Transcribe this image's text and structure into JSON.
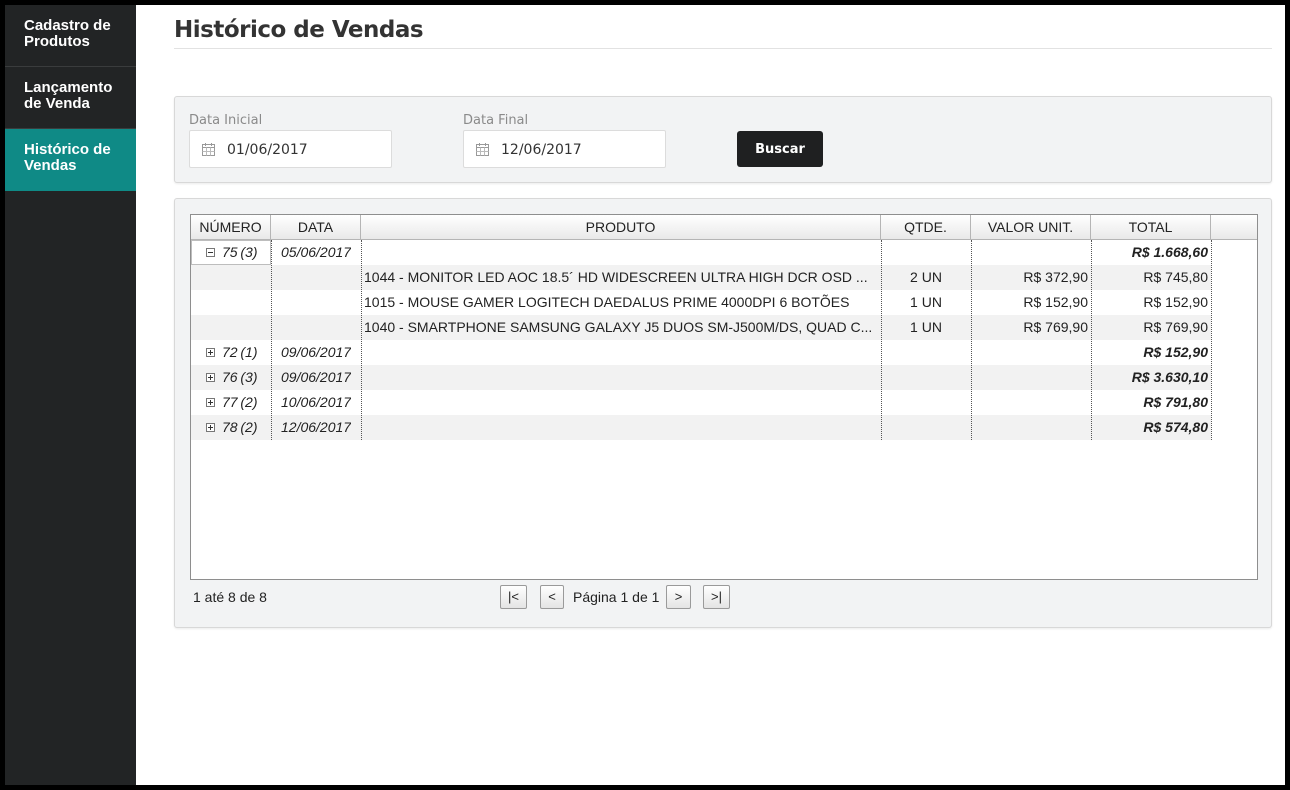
{
  "sidebar": {
    "items": [
      {
        "label_line1": "Cadastro de",
        "label_line2": "Produtos"
      },
      {
        "label_line1": "Lançamento",
        "label_line2": "de Venda"
      },
      {
        "label_line1": "Histórico de",
        "label_line2": "Vendas"
      }
    ],
    "active_index": 2
  },
  "page": {
    "title": "Histórico de Vendas"
  },
  "filters": {
    "start_label": "Data Inicial",
    "start_value": "01/06/2017",
    "end_label": "Data Final",
    "end_value": "12/06/2017",
    "search_button": "Buscar"
  },
  "grid": {
    "columns": [
      "NÚMERO",
      "DATA",
      "PRODUTO",
      "QTDE.",
      "VALOR UNIT.",
      "TOTAL"
    ],
    "rows": [
      {
        "type": "group",
        "expanded": true,
        "number": "75",
        "count": "(3)",
        "date": "05/06/2017",
        "total": "R$ 1.668,60"
      },
      {
        "type": "item",
        "product": "1044 - MONITOR LED AOC 18.5´ HD WIDESCREEN ULTRA HIGH DCR OSD ...",
        "qty": "2 UN",
        "unit": "R$ 372,90",
        "total": "R$ 745,80"
      },
      {
        "type": "item",
        "product": "1015 - MOUSE GAMER LOGITECH DAEDALUS PRIME 4000DPI 6 BOTÕES",
        "qty": "1 UN",
        "unit": "R$ 152,90",
        "total": "R$ 152,90"
      },
      {
        "type": "item",
        "product": "1040 - SMARTPHONE SAMSUNG GALAXY J5 DUOS SM-J500M/DS, QUAD C...",
        "qty": "1 UN",
        "unit": "R$ 769,90",
        "total": "R$ 769,90"
      },
      {
        "type": "group",
        "expanded": false,
        "number": "72",
        "count": "(1)",
        "date": "09/06/2017",
        "total": "R$ 152,90"
      },
      {
        "type": "group",
        "expanded": false,
        "number": "76",
        "count": "(3)",
        "date": "09/06/2017",
        "total": "R$ 3.630,10"
      },
      {
        "type": "group",
        "expanded": false,
        "number": "77",
        "count": "(2)",
        "date": "10/06/2017",
        "total": "R$ 791,80"
      },
      {
        "type": "group",
        "expanded": false,
        "number": "78",
        "count": "(2)",
        "date": "12/06/2017",
        "total": "R$ 574,80"
      }
    ]
  },
  "pager": {
    "info": "1 até 8 de 8",
    "first": "|<",
    "prev": "<",
    "label": "Página 1 de 1",
    "next": ">",
    "last": ">|"
  }
}
